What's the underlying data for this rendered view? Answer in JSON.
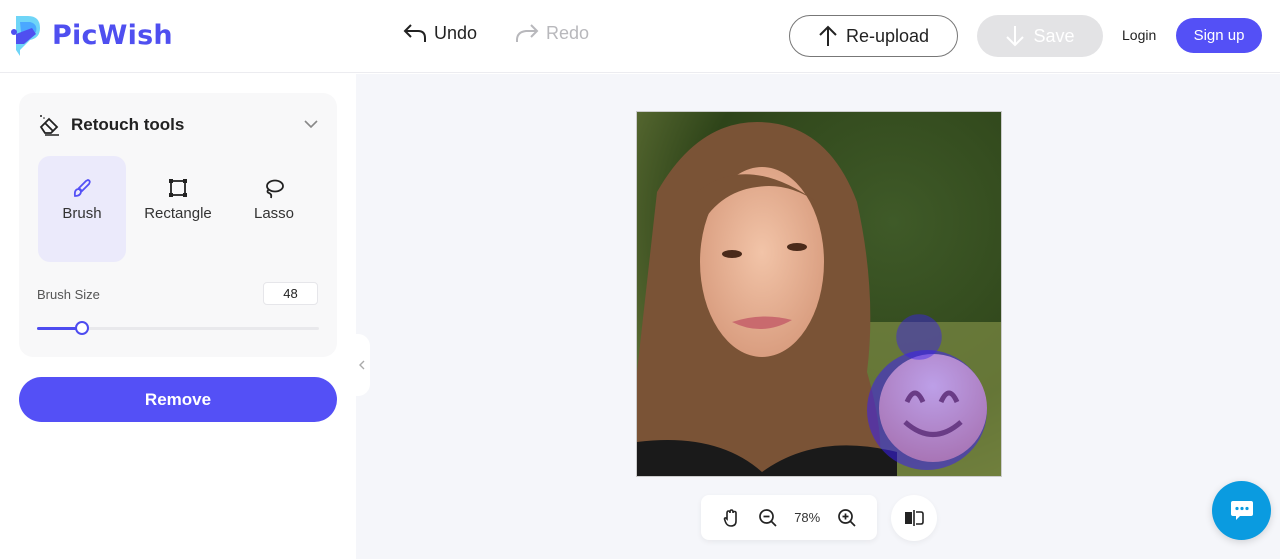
{
  "brand": {
    "name": "PicWish",
    "accent": "#5450f6"
  },
  "header": {
    "undo_label": "Undo",
    "redo_label": "Redo",
    "reupload_label": "Re-upload",
    "save_label": "Save",
    "login_label": "Login",
    "signup_label": "Sign up"
  },
  "sidebar": {
    "panel_title": "Retouch tools",
    "tools": [
      {
        "label": "Brush",
        "icon": "brush-icon",
        "active": true
      },
      {
        "label": "Rectangle",
        "icon": "rectangle-icon",
        "active": false
      },
      {
        "label": "Lasso",
        "icon": "lasso-icon",
        "active": false
      }
    ],
    "brush_size_label": "Brush Size",
    "brush_size_value": "48",
    "brush_size_fraction": 0.16,
    "remove_label": "Remove"
  },
  "canvas": {
    "zoom_level": "78%",
    "image_description": "Portrait photo of a woman with brush mask over an emoji"
  }
}
